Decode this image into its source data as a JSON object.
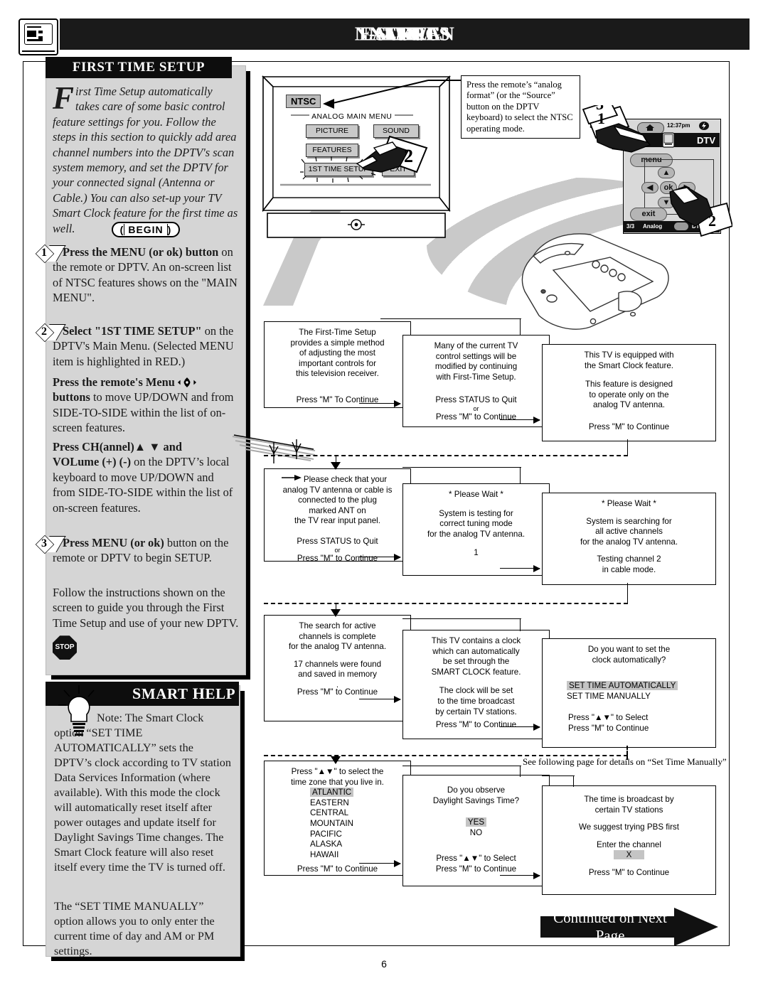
{
  "header": {
    "title": "NTSC/Analog On-screen Menu Features",
    "title_parts": {
      "p1": "NTSC/A",
      "p2": "NALOG",
      "p3": " O",
      "p4": "N-SCREEN",
      "p5": " M",
      "p6": "ENU",
      "p7": " F",
      "p8": "EATURES"
    },
    "icon": "tv-manual-icon"
  },
  "left_panel": {
    "heading": "FIRST TIME SETUP",
    "intro_dropcap": "F",
    "intro": "irst Time Setup automatically takes care of some basic control feature settings for you. Follow the steps in this section to quickly add area channel numbers into the DPTV's scan system memory, and set the DPTV for your connected signal  (Antenna or Cable.) You can also set-up your TV Smart Clock feature for the first time as well.",
    "begin_label": "BEGIN",
    "steps": [
      {
        "num": "1",
        "bold": "Press the MENU (or ok) button",
        "rest": " on the remote or DPTV. An on-screen list of NTSC features shows on the \"MAIN MENU\"."
      },
      {
        "num": "2",
        "bold": "Select \"1ST TIME SETUP\"",
        "rest": " on the DPTV's Main Menu. (Selected MENU item is highlighted in RED.)"
      },
      {
        "num": "3",
        "bold": "Press MENU (or ok)",
        "rest": " button on the remote or DPTV to begin SETUP."
      }
    ],
    "para_menu_bold": "Press the remote's Menu",
    "para_menu_bold2": "buttons",
    "para_menu_rest": " to move UP/DOWN and from SIDE-TO-SIDE within the list of on-screen features.",
    "para_ch_bold": "Press CH(annel)▲ ▼ and",
    "para_ch_bold2": "VOLume (+) (-)",
    "para_ch_rest": " on the DPTV’s local keyboard to move UP/DOWN and from SIDE-TO-SIDE within the list of on-screen features.",
    "follow_text": "Follow the instructions shown on the screen to guide you through the First Time Setup and use of your new DPTV.",
    "stop_label": "STOP"
  },
  "smart_help": {
    "heading": "SMART HELP",
    "heading_parts": {
      "s": "S",
      "mart": "MART",
      "h": " H",
      "elp": "ELP"
    },
    "body": "Note: The Smart Clock option “SET TIME AUTOMATICALLY” sets the DPTV’s clock according to TV station Data Services Information (where available). With this mode the clock will automatically reset itself after power outages and update itself for Daylight Savings Time changes. The Smart Clock feature will also reset itself every time the TV is turned off.",
    "body2": "The “SET TIME MANUALLY” option allows you to only enter the current time of day and AM or PM settings.",
    "icon": "lightbulb-icon"
  },
  "tv_illustration": {
    "ntsc_tag": "NTSC",
    "menu_title": "ANALOG MAIN MENU",
    "buttons": [
      {
        "label": "PICTURE"
      },
      {
        "label": "SOUND"
      },
      {
        "label": "FEATURES"
      },
      {
        "label": "1ST TIME SETUP"
      },
      {
        "label": "EXIT"
      }
    ],
    "hand_step": "2",
    "callout": "Press the remote’s “analog format” (or the “Source” button on the DPTV keyboard) to select the NTSC operating mode."
  },
  "remote": {
    "clock": "12:37pm",
    "mode": "DTV",
    "menu_label": "menu",
    "ok_label": "ok",
    "exit_label": "exit",
    "status_left": "3/3",
    "status_analog": "Analog",
    "status_right": "DTV",
    "hand_step_top_a": "3",
    "hand_step_top_b": "1",
    "hand_step_bottom": "2"
  },
  "flow": {
    "row1": [
      {
        "lines": [
          "The First-Time Setup",
          "provides a simple method",
          "of adjusting the most",
          "important controls for",
          "this television receiver."
        ],
        "footer": [
          "Press \"M\" To Continue"
        ]
      },
      {
        "lines": [
          "Many of the current TV",
          "control settings will be",
          "modified by continuing",
          "with First-Time Setup."
        ],
        "footer": [
          "Press STATUS to Quit",
          "or",
          "Press \"M\" to Continue"
        ]
      },
      {
        "lines": [
          "This TV is equipped with",
          "the Smart Clock feature.",
          "",
          "This feature is designed",
          "to operate only on the",
          "analog TV antenna."
        ],
        "footer": [
          "Press \"M\" to Continue"
        ]
      }
    ],
    "row2": [
      {
        "lines": [
          "Please check that your",
          "analog TV antenna or cable is",
          "connected to the plug",
          "marked ANT on",
          "the TV rear input panel."
        ],
        "footer": [
          "Press STATUS to Quit",
          "or",
          "Press \"M\" to Continue"
        ]
      },
      {
        "lines": [
          "* Please Wait *",
          "",
          "System is testing for",
          "correct tuning mode",
          "for the analog TV antenna.",
          "",
          "1"
        ],
        "footer": []
      },
      {
        "lines": [
          "* Please Wait *",
          "",
          "System is searching for",
          "all active channels",
          "for the analog TV antenna.",
          "",
          "Testing channel 2",
          "in cable mode."
        ],
        "footer": []
      }
    ],
    "row3": [
      {
        "lines": [
          "The search for active",
          "channels is complete",
          "for the analog TV antenna.",
          "",
          "17 channels were found",
          "and saved in memory",
          "."
        ],
        "footer": [
          "Press \"M\" to Continue"
        ]
      },
      {
        "lines": [
          "This TV contains a clock",
          "which can automatically",
          "be set through the",
          "SMART CLOCK feature.",
          "",
          "The clock will be set",
          "to the time broadcast",
          "by certain TV stations."
        ],
        "footer": [
          "Press \"M\" to Continue"
        ]
      },
      {
        "lines": [
          "Do you want to set the",
          "clock automatically?"
        ],
        "options": [
          "SET TIME AUTOMATICALLY",
          "SET TIME MANUALLY"
        ],
        "selected": "SET TIME AUTOMATICALLY",
        "footer": [
          "Press  \"▲▼\" to Select",
          "Press \"M\" to Continue"
        ]
      }
    ],
    "row4": [
      {
        "lines": [
          "Press \"▲▼\" to select the",
          "time zone that you live in."
        ],
        "options": [
          "ATLANTIC",
          "EASTERN",
          "CENTRAL",
          "MOUNTAIN",
          "PACIFIC",
          "ALASKA",
          "HAWAII"
        ],
        "selected": "ATLANTIC",
        "footer": [
          "Press \"M\" to Continue"
        ]
      },
      {
        "lines": [
          "Do you observe",
          "Daylight Savings Time?"
        ],
        "options": [
          "YES",
          "NO"
        ],
        "selected": "YES",
        "footer": [
          "Press  \"▲▼\" to Select",
          "Press \"M\" to Continue"
        ]
      },
      {
        "lines": [
          "The time is broadcast by",
          "certain TV stations",
          "",
          "We suggest trying PBS first",
          "",
          "Enter the channel"
        ],
        "field_value": "X",
        "footer": [
          "Press \"M\" to Continue"
        ]
      }
    ],
    "note": "See following page for details on “Set Time Manually”"
  },
  "footer": {
    "continued": "Continued on Next Page",
    "page_number": "6"
  }
}
